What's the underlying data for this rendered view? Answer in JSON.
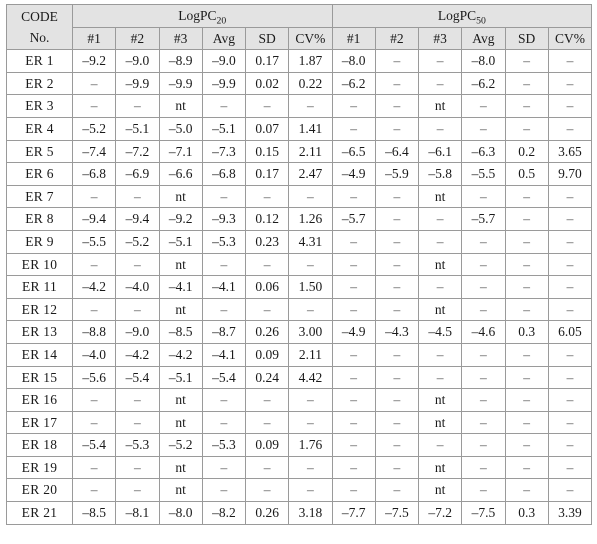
{
  "table": {
    "code_header": {
      "line1": "CODE",
      "line2": "No."
    },
    "groups": [
      {
        "name": "LogPC20",
        "label_base": "LogPC",
        "label_sub": "20",
        "span": 6
      },
      {
        "name": "LogPC50",
        "label_base": "LogPC",
        "label_sub": "50",
        "span": 6
      }
    ],
    "sub_headers": [
      "#1",
      "#2",
      "#3",
      "Avg",
      "SD",
      "CV%",
      "#1",
      "#2",
      "#3",
      "Avg",
      "SD",
      "CV%"
    ],
    "rows": [
      {
        "code": "ER 1",
        "cells": [
          "–9.2",
          "–9.0",
          "–8.9",
          "–9.0",
          "0.17",
          "1.87",
          "–8.0",
          "–",
          "–",
          "–8.0",
          "–",
          "–"
        ]
      },
      {
        "code": "ER 2",
        "cells": [
          "–",
          "–9.9",
          "–9.9",
          "–9.9",
          "0.02",
          "0.22",
          "–6.2",
          "–",
          "–",
          "–6.2",
          "–",
          "–"
        ]
      },
      {
        "code": "ER 3",
        "cells": [
          "–",
          "–",
          "nt",
          "–",
          "–",
          "–",
          "–",
          "–",
          "nt",
          "–",
          "–",
          "–"
        ]
      },
      {
        "code": "ER 4",
        "cells": [
          "–5.2",
          "–5.1",
          "–5.0",
          "–5.1",
          "0.07",
          "1.41",
          "–",
          "–",
          "–",
          "–",
          "–",
          "–"
        ]
      },
      {
        "code": "ER 5",
        "cells": [
          "–7.4",
          "–7.2",
          "–7.1",
          "–7.3",
          "0.15",
          "2.11",
          "–6.5",
          "–6.4",
          "–6.1",
          "–6.3",
          "0.2",
          "3.65"
        ]
      },
      {
        "code": "ER 6",
        "cells": [
          "–6.8",
          "–6.9",
          "–6.6",
          "–6.8",
          "0.17",
          "2.47",
          "–4.9",
          "–5.9",
          "–5.8",
          "–5.5",
          "0.5",
          "9.70"
        ]
      },
      {
        "code": "ER 7",
        "cells": [
          "–",
          "–",
          "nt",
          "–",
          "–",
          "–",
          "–",
          "–",
          "nt",
          "–",
          "–",
          "–"
        ]
      },
      {
        "code": "ER 8",
        "cells": [
          "–9.4",
          "–9.4",
          "–9.2",
          "–9.3",
          "0.12",
          "1.26",
          "–5.7",
          "–",
          "–",
          "–5.7",
          "–",
          "–"
        ]
      },
      {
        "code": "ER 9",
        "cells": [
          "–5.5",
          "–5.2",
          "–5.1",
          "–5.3",
          "0.23",
          "4.31",
          "–",
          "–",
          "–",
          "–",
          "–",
          "–"
        ]
      },
      {
        "code": "ER 10",
        "cells": [
          "–",
          "–",
          "nt",
          "–",
          "–",
          "–",
          "–",
          "–",
          "nt",
          "–",
          "–",
          "–"
        ]
      },
      {
        "code": "ER 11",
        "cells": [
          "–4.2",
          "–4.0",
          "–4.1",
          "–4.1",
          "0.06",
          "1.50",
          "–",
          "–",
          "–",
          "–",
          "–",
          "–"
        ]
      },
      {
        "code": "ER 12",
        "cells": [
          "–",
          "–",
          "nt",
          "–",
          "–",
          "–",
          "–",
          "–",
          "nt",
          "–",
          "–",
          "–"
        ]
      },
      {
        "code": "ER 13",
        "cells": [
          "–8.8",
          "–9.0",
          "–8.5",
          "–8.7",
          "0.26",
          "3.00",
          "–4.9",
          "–4.3",
          "–4.5",
          "–4.6",
          "0.3",
          "6.05"
        ]
      },
      {
        "code": "ER 14",
        "cells": [
          "–4.0",
          "–4.2",
          "–4.2",
          "–4.1",
          "0.09",
          "2.11",
          "–",
          "–",
          "–",
          "–",
          "–",
          "–"
        ]
      },
      {
        "code": "ER 15",
        "cells": [
          "–5.6",
          "–5.4",
          "–5.1",
          "–5.4",
          "0.24",
          "4.42",
          "–",
          "–",
          "–",
          "–",
          "–",
          "–"
        ]
      },
      {
        "code": "ER 16",
        "cells": [
          "–",
          "–",
          "nt",
          "–",
          "–",
          "–",
          "–",
          "–",
          "nt",
          "–",
          "–",
          "–"
        ]
      },
      {
        "code": "ER 17",
        "cells": [
          "–",
          "–",
          "nt",
          "–",
          "–",
          "–",
          "–",
          "–",
          "nt",
          "–",
          "–",
          "–"
        ]
      },
      {
        "code": "ER 18",
        "cells": [
          "–5.4",
          "–5.3",
          "–5.2",
          "–5.3",
          "0.09",
          "1.76",
          "–",
          "–",
          "–",
          "–",
          "–",
          "–"
        ]
      },
      {
        "code": "ER 19",
        "cells": [
          "–",
          "–",
          "nt",
          "–",
          "–",
          "–",
          "–",
          "–",
          "nt",
          "–",
          "–",
          "–"
        ]
      },
      {
        "code": "ER 20",
        "cells": [
          "–",
          "–",
          "nt",
          "–",
          "–",
          "–",
          "–",
          "–",
          "nt",
          "–",
          "–",
          "–"
        ]
      },
      {
        "code": "ER 21",
        "cells": [
          "–8.5",
          "–8.1",
          "–8.0",
          "–8.2",
          "0.26",
          "3.18",
          "–7.7",
          "–7.5",
          "–7.2",
          "–7.5",
          "0.3",
          "3.39"
        ]
      }
    ]
  }
}
